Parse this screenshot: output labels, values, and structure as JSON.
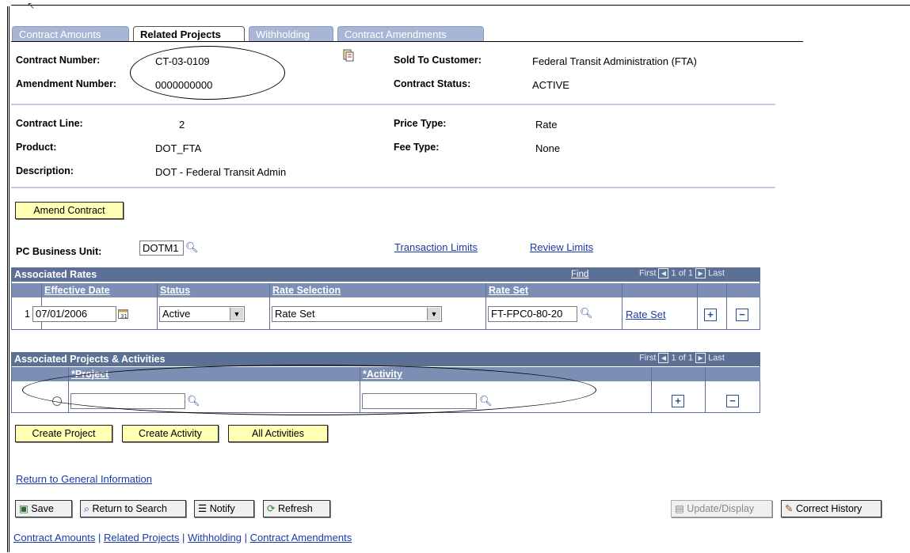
{
  "tabs": [
    "Contract Amounts",
    "Related Projects",
    "Withholding",
    "Contract Amendments"
  ],
  "header": {
    "contract_number_label": "Contract Number:",
    "contract_number": "CT-03-0109",
    "amendment_number_label": "Amendment Number:",
    "amendment_number": "0000000000",
    "sold_to_label": "Sold To Customer:",
    "sold_to": "Federal Transit Administration (FTA)",
    "status_label": "Contract Status:",
    "status": "ACTIVE"
  },
  "line": {
    "contract_line_label": "Contract Line:",
    "contract_line": "2",
    "product_label": "Product:",
    "product": "DOT_FTA",
    "description_label": "Description:",
    "description": "DOT - Federal Transit Admin",
    "price_type_label": "Price Type:",
    "price_type": "Rate",
    "fee_type_label": "Fee Type:",
    "fee_type": "None"
  },
  "amend_button": "Amend Contract",
  "pc_bu_label": "PC Business Unit:",
  "pc_bu_value": "DOTM1",
  "transaction_limits": "Transaction Limits",
  "review_limits": "Review Limits",
  "rates_grid": {
    "title": "Associated Rates",
    "find": "Find",
    "first": "First",
    "count": "1 of 1",
    "last": "Last",
    "columns": [
      "Effective Date",
      "Status",
      "Rate Selection",
      "Rate Set"
    ],
    "row_num": "1",
    "effective_date": "07/01/2006",
    "status": "Active",
    "rate_selection": "Rate Set",
    "rate_set": "FT-FPC0-80-20",
    "rate_set_link": "Rate Set"
  },
  "projects_grid": {
    "title": "Associated Projects & Activities",
    "first": "First",
    "count": "1 of 1",
    "last": "Last",
    "col_project": "*Project",
    "col_activity": "*Activity",
    "project_value": "",
    "activity_value": ""
  },
  "action_buttons": [
    "Create Project",
    "Create Activity",
    "All Activities"
  ],
  "return_link": "Return to General Information",
  "toolbar": {
    "save": "Save",
    "return_to_search": "Return to Search",
    "notify": "Notify",
    "refresh": "Refresh",
    "update_display": "Update/Display",
    "correct_history": "Correct History"
  },
  "footer_links": [
    "Contract Amounts",
    "Related Projects",
    "Withholding",
    "Contract Amendments"
  ],
  "footer_sep": "|"
}
